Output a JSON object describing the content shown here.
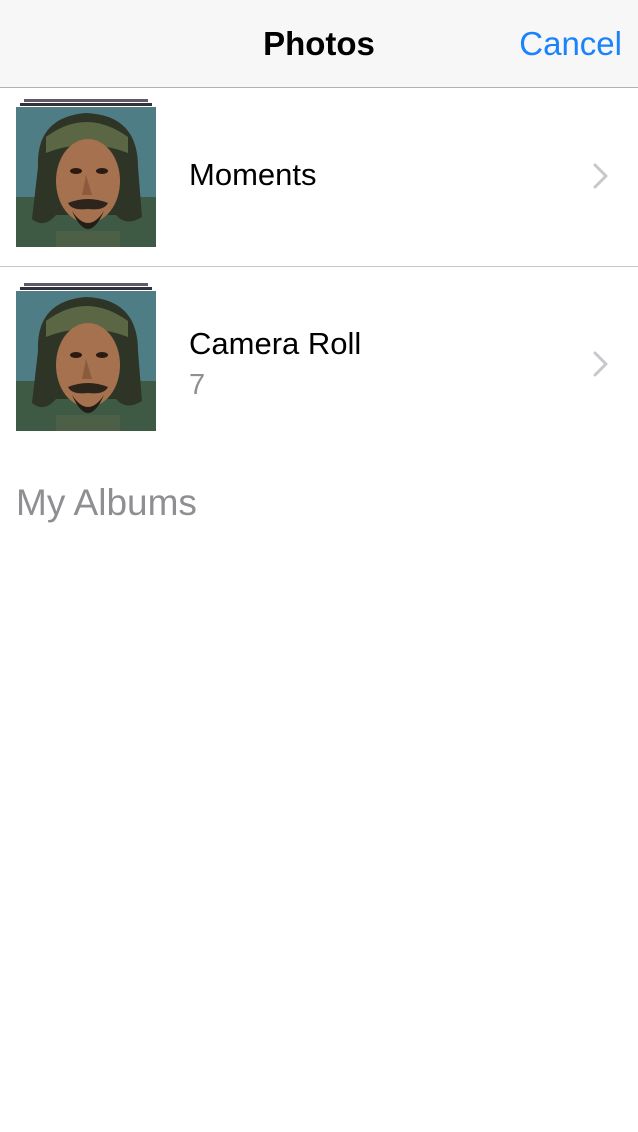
{
  "navbar": {
    "title": "Photos",
    "cancel_label": "Cancel"
  },
  "albums": [
    {
      "title": "Moments",
      "count": ""
    },
    {
      "title": "Camera Roll",
      "count": "7"
    }
  ],
  "sections": {
    "my_albums": "My Albums"
  },
  "colors": {
    "accent": "#1a82fb",
    "secondary_text": "#8e8e93",
    "separator": "#c8c7cc",
    "navbar_bg": "#f7f7f7"
  },
  "icons": {
    "chevron": "chevron-right-icon"
  }
}
